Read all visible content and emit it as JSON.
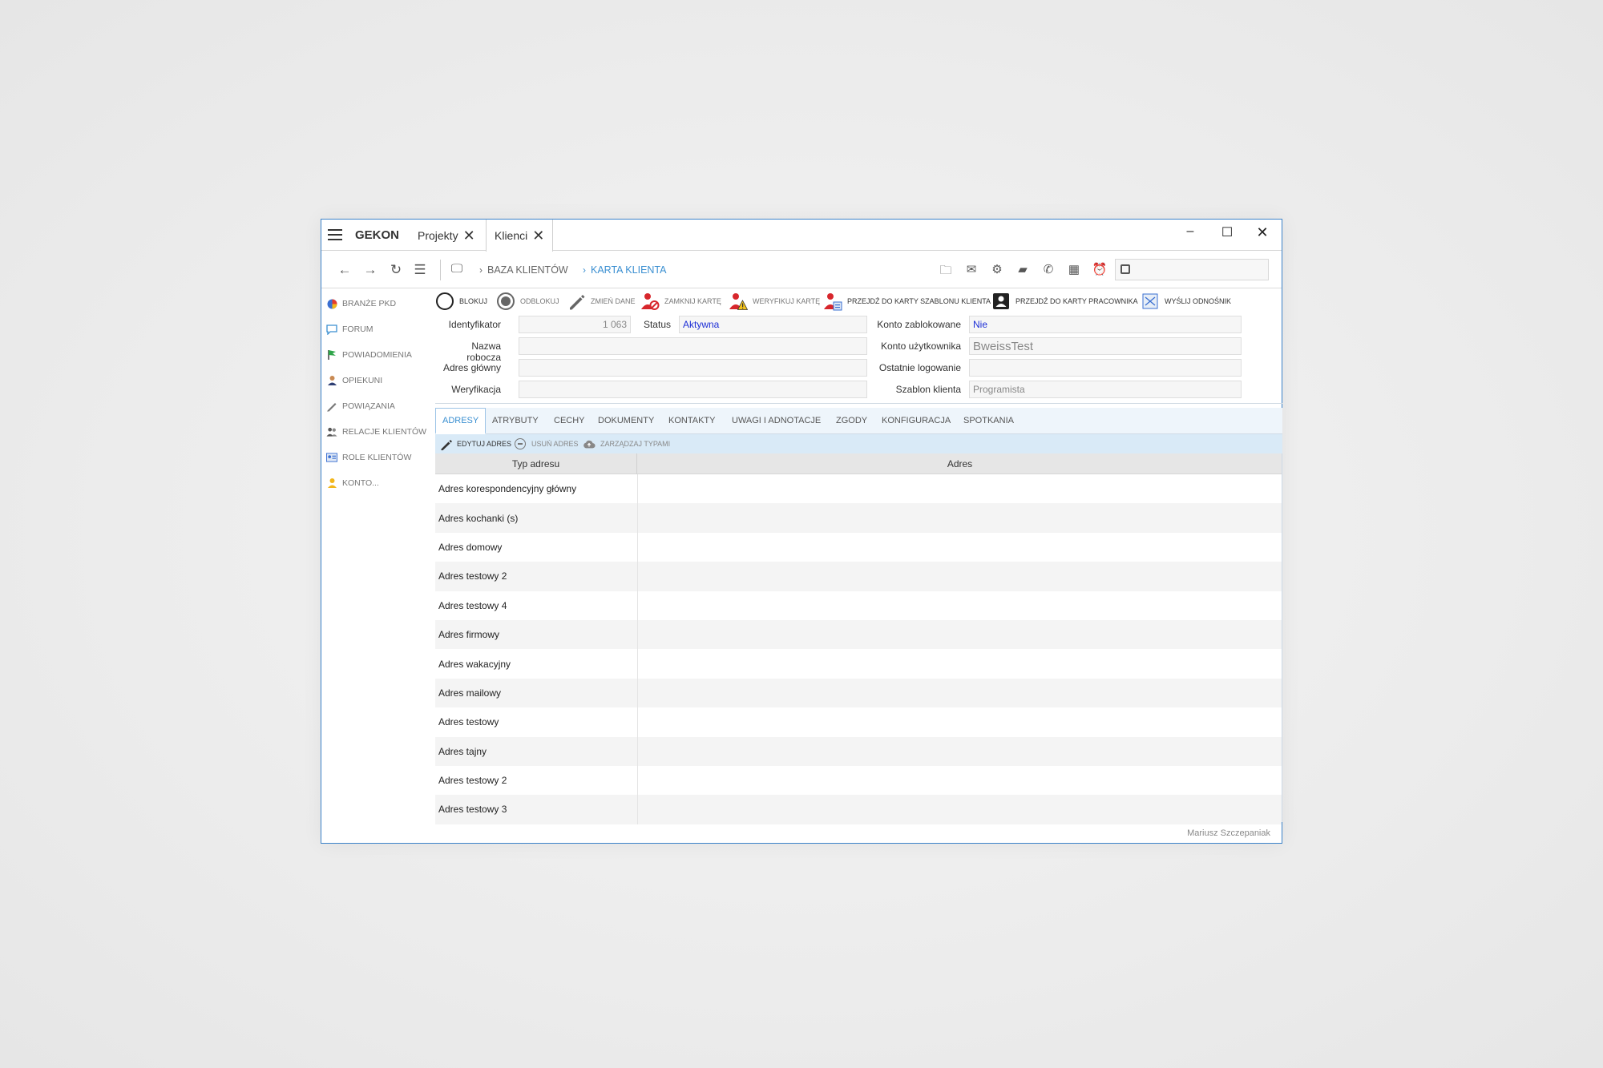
{
  "window": {
    "app_title": "GEKON",
    "tabs": [
      {
        "label": "Projekty"
      },
      {
        "label": "Klienci"
      }
    ],
    "controls": {
      "minimize": "–",
      "maximize": "☐",
      "close": "✕"
    }
  },
  "navbar": {
    "breadcrumbs": [
      {
        "label": "BAZA KLIENTÓW"
      },
      {
        "label": "KARTA KLIENTA"
      }
    ],
    "search": {
      "value": "",
      "placeholder": ""
    }
  },
  "sidebar": {
    "items": [
      {
        "label": "BRANŻE PKD",
        "icon": "pie-chart-icon"
      },
      {
        "label": "FORUM",
        "icon": "chat-icon"
      },
      {
        "label": "POWIADOMIENIA",
        "icon": "flag-icon"
      },
      {
        "label": "OPIEKUNI",
        "icon": "person-icon"
      },
      {
        "label": "POWIĄZANIA",
        "icon": "pen-icon"
      },
      {
        "label": "RELACJE KLIENTÓW",
        "icon": "people-icon"
      },
      {
        "label": "ROLE KLIENTÓW",
        "icon": "id-card-icon"
      },
      {
        "label": "KONTO...",
        "icon": "user-yellow-icon"
      }
    ]
  },
  "actions": {
    "blokuj": "BLOKUJ",
    "odblokuj": "ODBLOKUJ",
    "zmien_dane": "ZMIEŃ DANE",
    "zamknij_karte": "ZAMKNIJ KARTĘ",
    "weryfikuj_karte": "WERYFIKUJ KARTĘ",
    "przejdz_szablon": "PRZEJDŹ DO KARTY SZABLONU KLIENTA",
    "przejdz_pracownik": "PRZEJDŹ DO KARTY PRACOWNIKA",
    "wyslij_odnosnik": "WYŚLIJ ODNOŚNIK"
  },
  "form": {
    "identyfikator": {
      "label": "Identyfikator",
      "value": "1 063"
    },
    "status": {
      "label": "Status",
      "value": "Aktywna"
    },
    "nazwa_robocza": {
      "label": "Nazwa robocza",
      "value": ""
    },
    "adres_glowny": {
      "label": "Adres główny",
      "value": ""
    },
    "weryfikacja": {
      "label": "Weryfikacja",
      "value": ""
    },
    "konto_zablokowane": {
      "label": "Konto zablokowane",
      "value": "Nie"
    },
    "konto_uzytkownika": {
      "label": "Konto użytkownika",
      "value": "BweissTest"
    },
    "ostatnie_logowanie": {
      "label": "Ostatnie logowanie",
      "value": ""
    },
    "szablon_klienta": {
      "label": "Szablon klienta",
      "value": "Programista"
    }
  },
  "panel_tabs": [
    "ADRESY",
    "ATRYBUTY",
    "CECHY",
    "DOKUMENTY",
    "KONTAKTY",
    "UWAGI I ADNOTACJE",
    "ZGODY",
    "KONFIGURACJA",
    "SPOTKANIA"
  ],
  "subactions": {
    "edytuj": "EDYTUJ ADRES",
    "usun": "USUŃ ADRES",
    "zarzadzaj": "ZARZĄDZAJ TYPAMI"
  },
  "table": {
    "headers": [
      "Typ adresu",
      "Adres"
    ],
    "rows": [
      {
        "typ": "Adres korespondencyjny główny",
        "adres": ""
      },
      {
        "typ": "Adres kochanki (s)",
        "adres": ""
      },
      {
        "typ": "Adres domowy",
        "adres": ""
      },
      {
        "typ": "Adres testowy 2",
        "adres": ""
      },
      {
        "typ": "Adres testowy 4",
        "adres": ""
      },
      {
        "typ": "Adres firmowy",
        "adres": ""
      },
      {
        "typ": "Adres wakacyjny",
        "adres": ""
      },
      {
        "typ": "Adres mailowy",
        "adres": ""
      },
      {
        "typ": "Adres testowy",
        "adres": ""
      },
      {
        "typ": "Adres tajny",
        "adres": ""
      },
      {
        "typ": "Adres testowy 2",
        "adres": ""
      },
      {
        "typ": "Adres testowy 3",
        "adres": ""
      }
    ]
  },
  "footer": {
    "user": "Mariusz Szczepaniak"
  },
  "colors": {
    "accent": "#3a8fd1",
    "window_border": "#3b82c9",
    "status_value": "#1d2fd6"
  }
}
